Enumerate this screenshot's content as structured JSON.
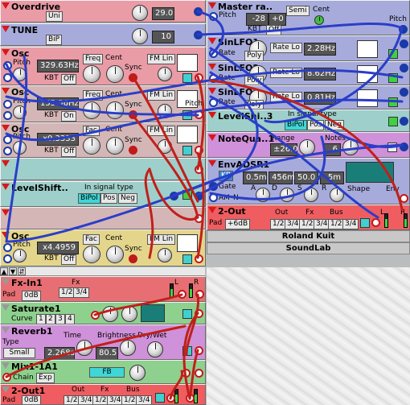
{
  "overdrive": {
    "title": "Overdrive",
    "mode": "Uni",
    "value": "29.0"
  },
  "tune": {
    "title": "TUNE",
    "mode": "BiP",
    "value": "10"
  },
  "osc1": {
    "title": "Osc",
    "pitch": "Pitch",
    "freq": "329.63Hz",
    "btn1": "Freq",
    "cent": "Cent",
    "kbt": "KBT",
    "kbt_state": "Off",
    "fm": "FM Lin",
    "sync": "Sync"
  },
  "osc2": {
    "title": "Osc",
    "pitch": "Pitch",
    "freq": "155.56Hz",
    "btn1": "Freq",
    "cent": "Cent",
    "kbt": "KBT",
    "kbt_state": "On",
    "fm": "FM Lin",
    "sync": "Sync"
  },
  "osc3": {
    "title": "Osc",
    "pitch": "Pitch",
    "freq": "x0.3333",
    "btn1": "Fac",
    "cent": "Cent",
    "kbt": "KBT",
    "kbt_state": "Off",
    "fm": "FM Lin",
    "sync": "Sync"
  },
  "levelshift_left": {
    "title": "LevelShift..",
    "sig_label": "In signal type",
    "opts": [
      "BiPol",
      "Pos",
      "Neg"
    ]
  },
  "osc4": {
    "title": "Osc",
    "pitch": "Pitch",
    "freq": "x4.4959",
    "btn1": "Fac",
    "cent": "Cent",
    "kbt": "KBT",
    "kbt_state": "Off",
    "fm": "FM Lin",
    "sync": "Sync"
  },
  "master": {
    "title": "Master ra..",
    "mode": "Semi",
    "cent": "Cent",
    "pitch": "Pitch",
    "value": "-28",
    "offset": "+0",
    "kbt": "KBT",
    "kbt_state": "Off",
    "pitch_out": "Pitch"
  },
  "sinlfo1": {
    "title": "SinLFO1",
    "rate": "Rate",
    "poly": "Poly",
    "rate_mode": "Rate Lo",
    "value": "2.28Hz"
  },
  "sinlfo2": {
    "title": "SinLFO2",
    "rate": "Rate",
    "poly": "Poly",
    "rate_mode": "Rate Lo",
    "value": "8.62Hz"
  },
  "sinlfo3": {
    "title": "SinLFO3",
    "rate": "Rate",
    "poly": "Poly",
    "rate_mode": "Rate Lo",
    "value": "0.81Hz"
  },
  "pitch_label": "Pitch",
  "levelshift_right": {
    "title": "LevelShi..3",
    "sig_label": "In signal type",
    "opts": [
      "BiPol",
      "Pos",
      "Neg"
    ]
  },
  "notequant": {
    "title": "NoteQua..1",
    "range": "Range",
    "notes": "Notes",
    "range_val": "±26.0",
    "notes_val": "6"
  },
  "envadsr": {
    "title": "EnvADSR1",
    "kb": "KB",
    "gate": "Gate",
    "am": "AM",
    "n": "N",
    "a": "A",
    "d": "D",
    "s": "S",
    "r": "R",
    "shape": "Shape",
    "env": "Env",
    "a_val": "0.5m",
    "d_val": "456m",
    "s_val": "50.0",
    "r_val": "5m"
  },
  "out2_top": {
    "title": "2-Out",
    "pad": "Pad",
    "pad_val": "+6dB",
    "out": "Out",
    "fx": "Fx",
    "bus": "Bus",
    "out_opts": [
      "1/2",
      "3/4"
    ],
    "fx_opts": [
      "1/2",
      "3/4"
    ],
    "bus_opts": [
      "1/2",
      "3/4"
    ],
    "l": "L",
    "r": "R"
  },
  "roland": "Roland Kuit",
  "soundlab": "SoundLab",
  "fxin": {
    "title": "Fx-In1",
    "fx": "Fx",
    "pad": "Pad",
    "pad_val": "0dB",
    "opts": [
      "1/2",
      "3/4"
    ],
    "l": "L",
    "r": "R"
  },
  "saturate": {
    "title": "Saturate1",
    "curve": "Curve",
    "opts": [
      "1",
      "2",
      "3",
      "4"
    ]
  },
  "reverb": {
    "title": "Reverb1",
    "type": "Type",
    "type_val": "Small",
    "time": "Time",
    "time_val": "2.268s",
    "brightness": "Brightness",
    "bright_val": "80.5",
    "drywet": "Dry/Wet"
  },
  "mix": {
    "title": "Mix1-1A1",
    "chain": "Chain",
    "exp": "Exp",
    "fb": "FB"
  },
  "out1": {
    "title": "2-Out1",
    "pad": "Pad",
    "pad_val": "0dB",
    "out": "Out",
    "fx": "Fx",
    "bus": "Bus",
    "out_opts": [
      "1/2",
      "3/4"
    ],
    "fx_opts": [
      "1/2",
      "3/4"
    ],
    "bus_opts": [
      "1/2",
      "3/4"
    ]
  },
  "colors": {
    "cable_blue": "#2a3ec8",
    "cable_red": "#c0201a"
  }
}
